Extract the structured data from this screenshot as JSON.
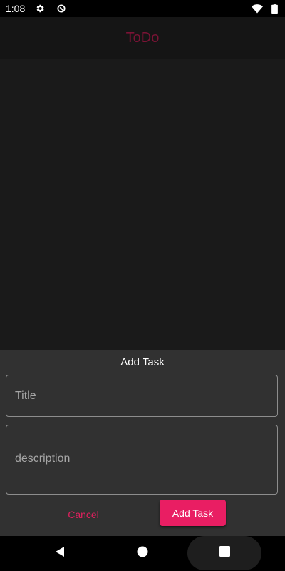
{
  "status_bar": {
    "time": "1:08"
  },
  "app_bar": {
    "title": "ToDo"
  },
  "sheet": {
    "title": "Add Task",
    "title_field": {
      "placeholder": "Title",
      "value": ""
    },
    "description_field": {
      "placeholder": "description",
      "value": ""
    },
    "cancel_label": "Cancel",
    "add_label": "Add Task"
  },
  "colors": {
    "accent": "#e91e63",
    "app_title": "#7a1335",
    "sheet_background": "#313131",
    "page_background": "#1a1a1a"
  },
  "icons": {
    "status": [
      "settings-icon",
      "data-saver-icon",
      "wifi-icon",
      "battery-icon"
    ],
    "navigation": [
      "back-icon",
      "home-icon",
      "recents-icon"
    ]
  }
}
